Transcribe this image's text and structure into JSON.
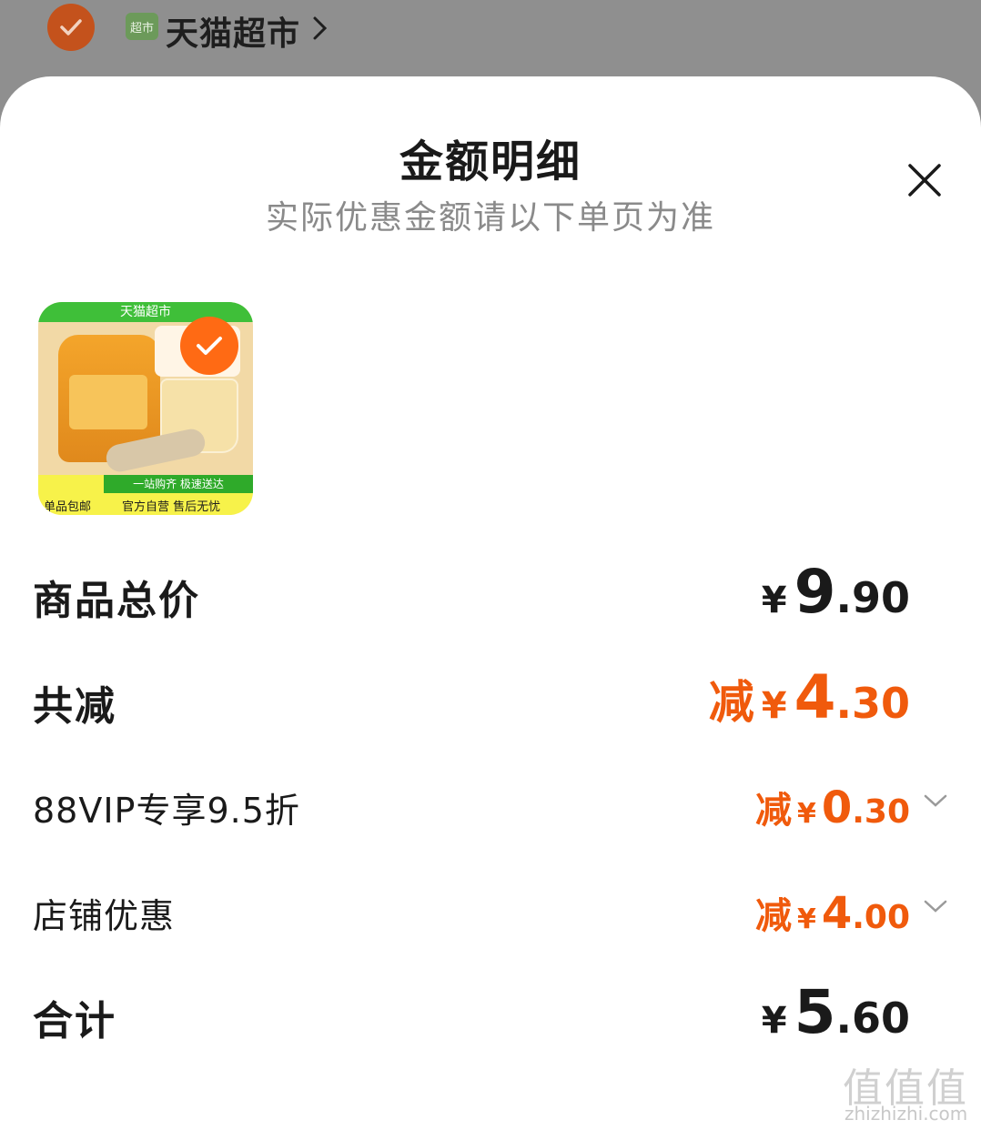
{
  "store": {
    "logo_text": "超市",
    "name": "天猫超市"
  },
  "sheet": {
    "title": "金额明细",
    "subtitle": "实际优惠金额请以下单页为准"
  },
  "product": {
    "banner": "天猫超市",
    "footer_green": "一站购齐 极速送达",
    "footer_tag": "单品包邮",
    "footer_text": "官方自营 售后无忧",
    "selected": true
  },
  "rows": {
    "total": {
      "label": "商品总价",
      "currency": "¥",
      "integer": "9",
      "decimal": ".90"
    },
    "discount": {
      "label": "共减",
      "prefix": "减",
      "currency": "¥",
      "integer": "4",
      "decimal": ".30"
    },
    "vip": {
      "label": "88VIP专享9.5折",
      "prefix": "减",
      "currency": "¥",
      "integer": "0",
      "decimal": ".30"
    },
    "shop": {
      "label": "店铺优惠",
      "prefix": "减",
      "currency": "¥",
      "integer": "4",
      "decimal": ".00"
    },
    "sum": {
      "label": "合计",
      "currency": "¥",
      "integer": "5",
      "decimal": ".60"
    }
  },
  "watermark": {
    "main": "值值值",
    "sub": "zhizhizhi.com"
  },
  "colors": {
    "accent": "#f05a0c",
    "text": "#1a1a1a",
    "muted": "#8a8a8a",
    "backdrop": "#8f8f8f"
  }
}
